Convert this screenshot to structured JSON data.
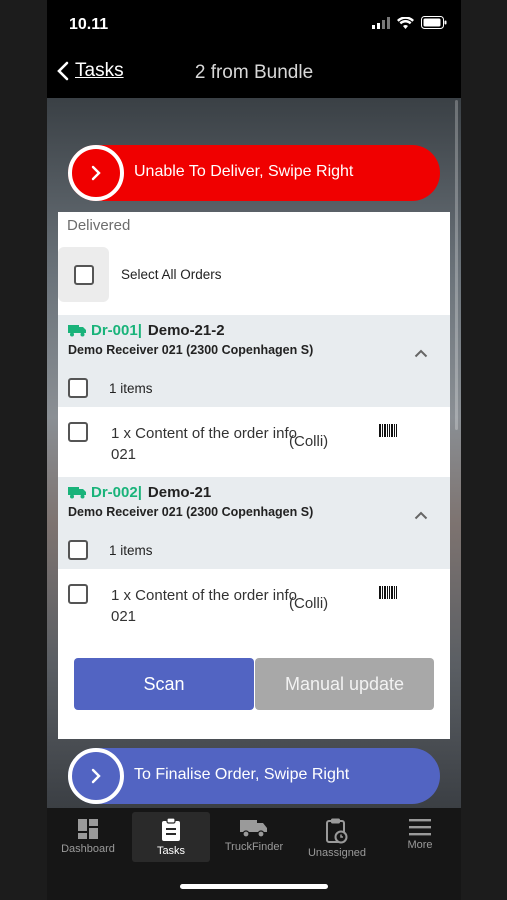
{
  "status": {
    "time": "10.11"
  },
  "nav": {
    "back_label": "Tasks",
    "title": "2 from Bundle"
  },
  "swipe_top": {
    "label": "Unable To Deliver, Swipe Right",
    "color": "#f00000"
  },
  "card": {
    "heading": "Delivered",
    "select_all_label": "Select All Orders",
    "orders": [
      {
        "code": "Dr-001|",
        "name": "Demo-21-2",
        "receiver": "Demo Receiver 021 (2300 Copenhagen S)",
        "items_label": "1 items",
        "line_text": "1 x Content of the order info 021",
        "line_unit": "(Colli)"
      },
      {
        "code": "Dr-002|",
        "name": "Demo-21",
        "receiver": "Demo Receiver 021 (2300 Copenhagen S)",
        "items_label": "1 items",
        "line_text": "1 x Content of the order info 021",
        "line_unit": "(Colli)"
      }
    ],
    "scan_label": "Scan",
    "manual_label": "Manual update"
  },
  "swipe_bottom": {
    "label": "To Finalise Order, Swipe Right",
    "color": "#5264c2"
  },
  "tabs": [
    {
      "label": "Dashboard",
      "icon": "dashboard-icon"
    },
    {
      "label": "Tasks",
      "icon": "clipboard-icon",
      "active": true
    },
    {
      "label": "TruckFinder",
      "icon": "truck-icon"
    },
    {
      "label": "Unassigned",
      "icon": "clipboard-clock-icon"
    },
    {
      "label": "More",
      "icon": "menu-icon"
    }
  ],
  "colors": {
    "accent": "#5264c2",
    "danger": "#f00000",
    "order_code": "#19b37a"
  }
}
